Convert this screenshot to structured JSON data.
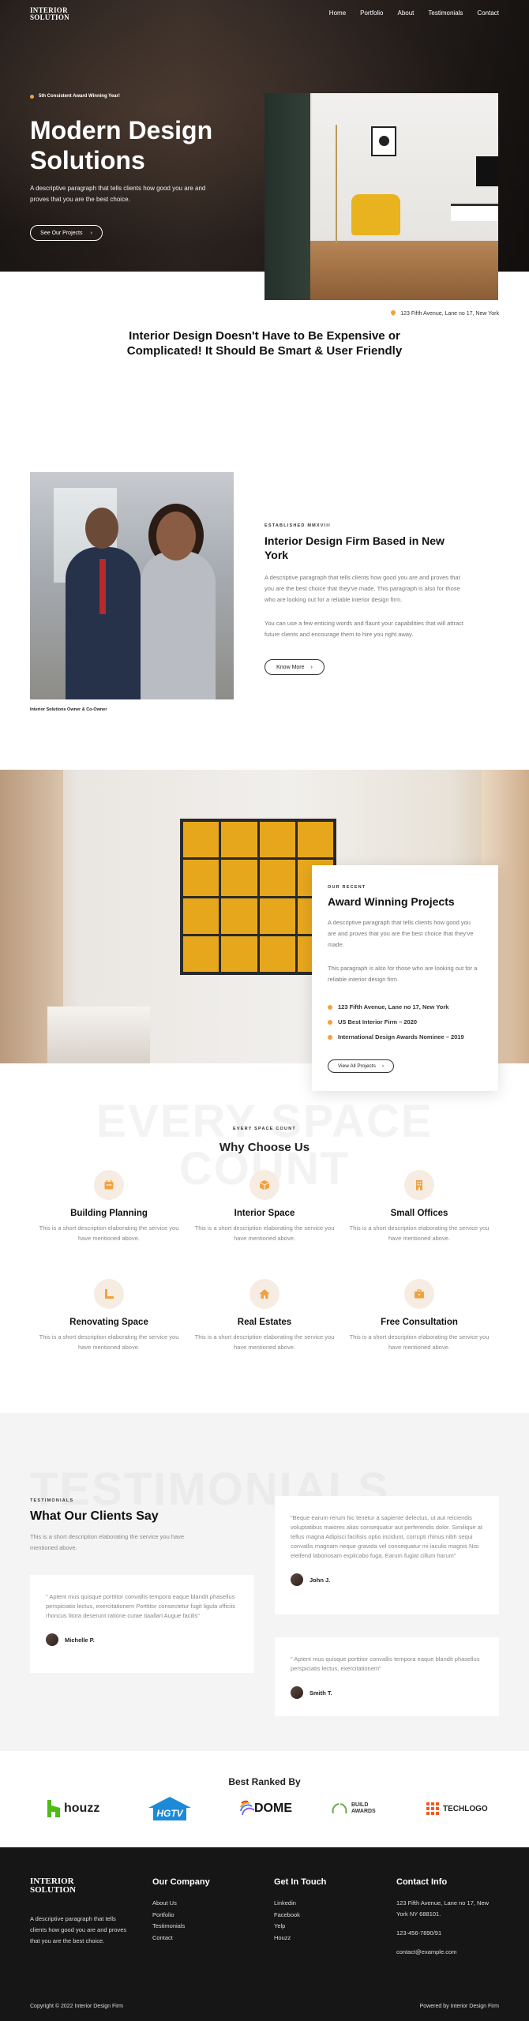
{
  "header": {
    "logo_line1": "INTERIOR",
    "logo_line2": "SOLUTION",
    "nav": [
      "Home",
      "Portfolio",
      "About",
      "Testimonials",
      "Contact"
    ]
  },
  "hero": {
    "award": "5th Consistent Award Winning Year!",
    "title": "Modern Design Solutions",
    "description": "A descriptive paragraph that tells clients how good you are and proves that you are the best choice.",
    "button": "See Our Projects",
    "address": "123 Fifth Avenue, Lane no 17, New York"
  },
  "intro": {
    "text": "Interior Design Doesn't Have to Be Expensive or Complicated! It Should Be Smart & User Friendly"
  },
  "about": {
    "caption": "Interior Solutions Owner & Co-Owner",
    "eyebrow": "ESTABLISHED MMXVIII",
    "title": "Interior Design Firm Based in New York",
    "p1": "A descriptive paragraph that tells clients how good you are and proves that you are the best choice that they've made. This paragraph is also for those who are looking out for a reliable interior design firm.",
    "p2": "You can use a few enticing words and flaunt your capabilities that will attract future clients and encourage them to hire you right away.",
    "button": "Know More"
  },
  "projects": {
    "eyebrow": "OUR RECENT",
    "title": "Award Winning Projects",
    "p1": "A descriptive paragraph that tells clients how good you are and proves that you are the best choice that they've made.",
    "p2": "This paragraph is also for those who are looking out for a reliable interior design firm.",
    "list": [
      "123 Fifth Avenue, Lane no 17, New York",
      "US Best Interior Firm – 2020",
      "International Design Awards Nominee – 2019"
    ],
    "button": "View All Projects"
  },
  "why": {
    "watermark_line1": "EVERY SPACE",
    "watermark_line2": "COUNT",
    "eyebrow": "EVERY SPACE COUNT",
    "title": "Why Choose Us",
    "services": [
      {
        "title": "Building Planning",
        "desc": "This is a short description elaborating the service you have mentioned above.",
        "icon": "calendar-icon"
      },
      {
        "title": "Interior Space",
        "desc": "This is a short description elaborating the service you have mentioned above.",
        "icon": "box-icon"
      },
      {
        "title": "Small Offices",
        "desc": "This is a short description elaborating the service you have mentioned above.",
        "icon": "building-icon"
      },
      {
        "title": "Renovating Space",
        "desc": "This is a short description elaborating the service you have mentioned above.",
        "icon": "ruler-icon"
      },
      {
        "title": "Real Estates",
        "desc": "This is a short description elaborating the service you have mentioned above.",
        "icon": "home-icon"
      },
      {
        "title": "Free Consultation",
        "desc": "This is a short description elaborating the service you have mentioned above.",
        "icon": "briefcase-icon"
      }
    ]
  },
  "testimonials": {
    "watermark": "TESTIMONIALS",
    "eyebrow": "TESTIMONIALS",
    "title": "What Our Clients Say",
    "subtitle": "This is a short description elaborating the service you have mentioned above.",
    "items": [
      {
        "quote": "\" Aptent mus quisque porttitor convallis tempora eaque blandit phasellus perspiciatis lectus, exercitationem Porttitor consectetur fugit ligula officiis rhoncus litora deserunt ratione curae tiaallari Augue facilis\"",
        "author": "Michelle P."
      },
      {
        "quote": "\"Beque earum rerum hic tenetur a sapiente delectus, ut aut reiciendis voluptatibus maiores alias consequatur aut perferendis dolor. Similique at tellus magna Adipisci facilisis optio incidunt, corrupti rhinus nibh sequi convallis magnam neque gravida vel consequatur mi iaculis magnis Nisi eleifend laboriosam explicabo fuga. Earum fugiat cillum harum\"",
        "author": "John J."
      },
      {
        "quote": "\" Aptent mus quisque porttitor convallis tempora eaque blandit phasellus perspiciatis lectus, exercitationem\"",
        "author": "Smith T."
      }
    ]
  },
  "ranked": {
    "title": "Best Ranked By",
    "brands": [
      "houzz",
      "HGTV",
      "DOME",
      "BUILD AWARDS",
      "TECHLOGO"
    ]
  },
  "footer": {
    "logo_line1": "INTERIOR",
    "logo_line2": "SOLUTION",
    "description": "A descriptive paragraph that tells clients how good you are and proves that you are the best choice.",
    "company_title": "Our Company",
    "company_links": [
      "About Us",
      "Portfolio",
      "Testimonials",
      "Contact"
    ],
    "touch_title": "Get In Touch",
    "touch_links": [
      "Linkedin",
      "Facebook",
      "Yelp",
      "Houzz"
    ],
    "contact_title": "Contact Info",
    "contact_address": "123 Fifth Avenue, Lane no 17, New York NY 688101.",
    "contact_phone": "123-456-7890/91",
    "contact_email": "contact@example.com",
    "copyright": "Copyright © 2022 Interior Design Firm",
    "powered": "Powered by Interior Design Firm"
  },
  "colors": {
    "accent": "#f2a23c",
    "dark": "#161616"
  }
}
